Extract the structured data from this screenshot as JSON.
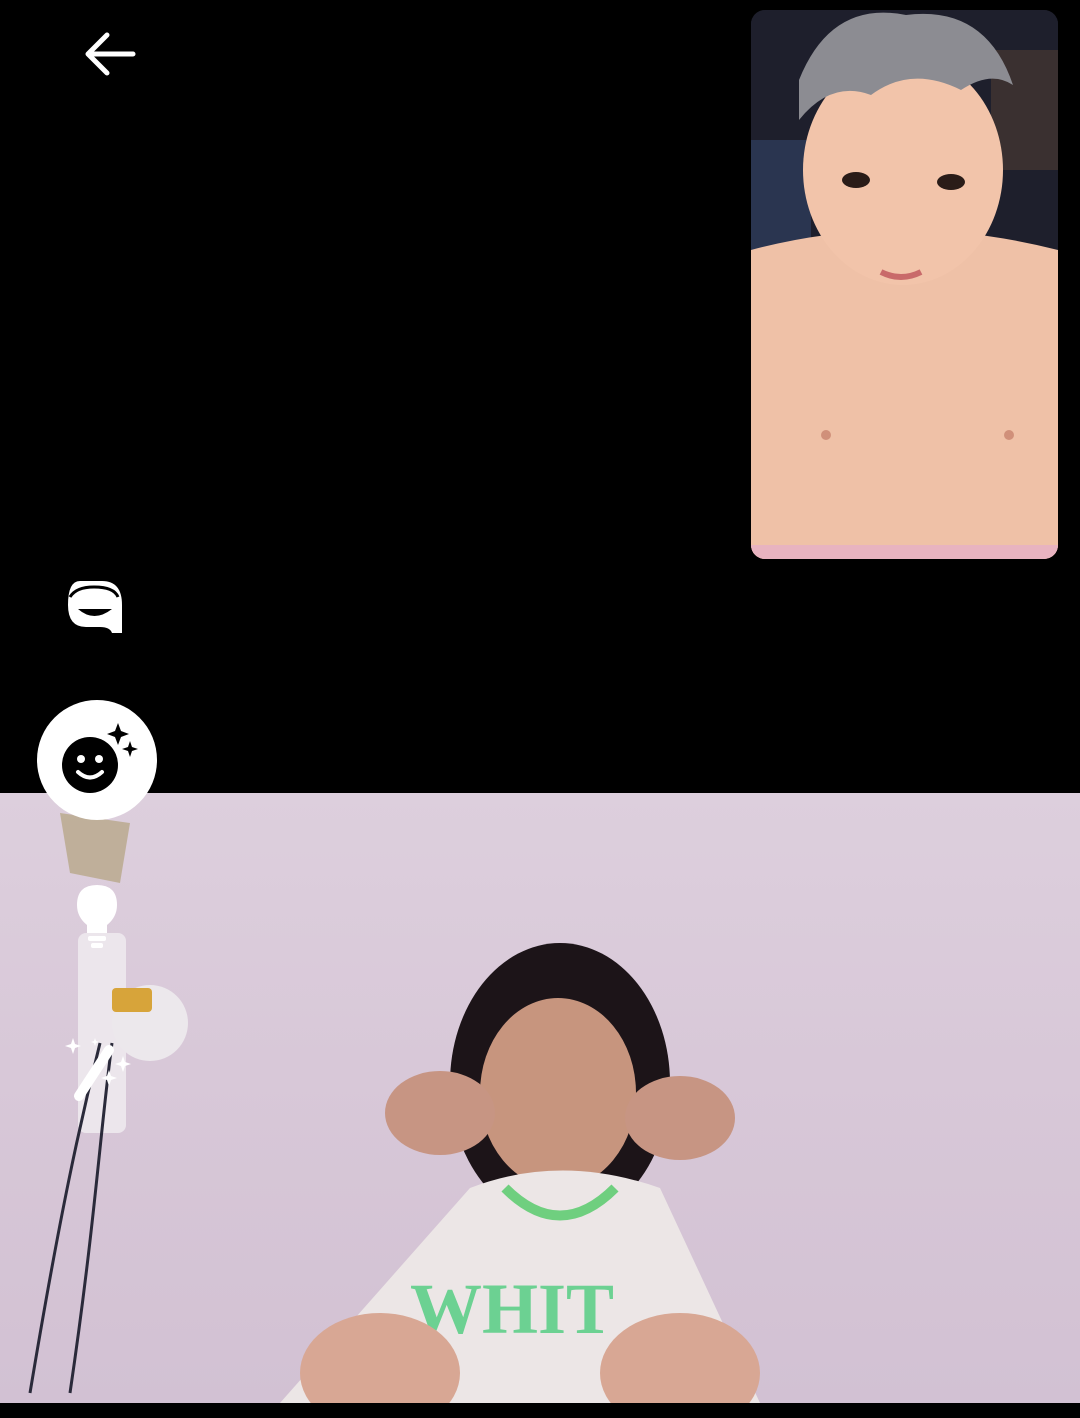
{
  "call": {
    "type": "video-call"
  },
  "toolbar": {
    "back": {
      "icon": "arrow-left-icon"
    },
    "avatar": {
      "icon": "avatar-face-icon"
    },
    "effects": {
      "icon": "face-sparkle-icon",
      "active": true
    },
    "low_light": {
      "icon": "lightbulb-icon"
    },
    "touch_up": {
      "icon": "magic-wand-icon"
    }
  },
  "theme": {
    "background": "#000000",
    "icon_color": "#ffffff",
    "active_button_bg": "#ffffff",
    "active_icon_color": "#000000"
  }
}
